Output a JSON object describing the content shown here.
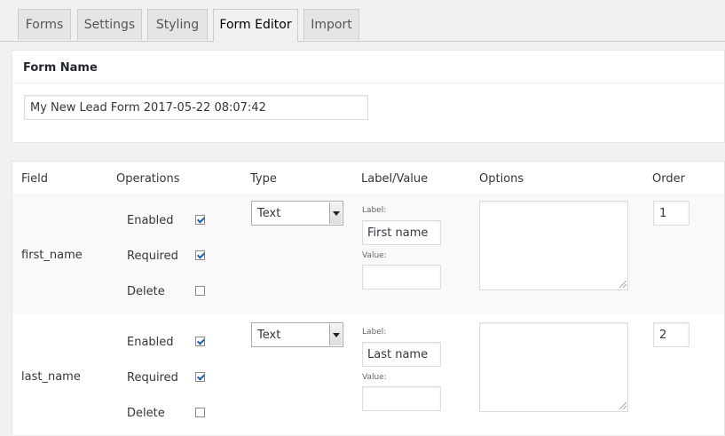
{
  "tabs": [
    {
      "label": "Forms"
    },
    {
      "label": "Settings"
    },
    {
      "label": "Styling"
    },
    {
      "label": "Form Editor",
      "active": true
    },
    {
      "label": "Import"
    }
  ],
  "form_name": {
    "title": "Form Name",
    "value": "My New Lead Form 2017-05-22 08:07:42"
  },
  "fields_table": {
    "headers": {
      "field": "Field",
      "operations": "Operations",
      "type": "Type",
      "label_value": "Label/Value",
      "options": "Options",
      "order": "Order"
    },
    "ops_labels": {
      "enabled": "Enabled",
      "required": "Required",
      "delete": "Delete"
    },
    "small_labels": {
      "label": "Label:",
      "value": "Value:"
    },
    "rows": [
      {
        "field": "first_name",
        "enabled": true,
        "required": true,
        "delete": false,
        "type": "Text",
        "label": "First name",
        "value": "",
        "options": "",
        "order": "1"
      },
      {
        "field": "last_name",
        "enabled": true,
        "required": true,
        "delete": false,
        "type": "Text",
        "label": "Last name",
        "value": "",
        "options": "",
        "order": "2"
      }
    ]
  },
  "colors": {
    "background": "#f1f1f1",
    "panel": "#ffffff",
    "row_alt": "#f9f9f9",
    "checkbox_check": "#1e63b5"
  }
}
